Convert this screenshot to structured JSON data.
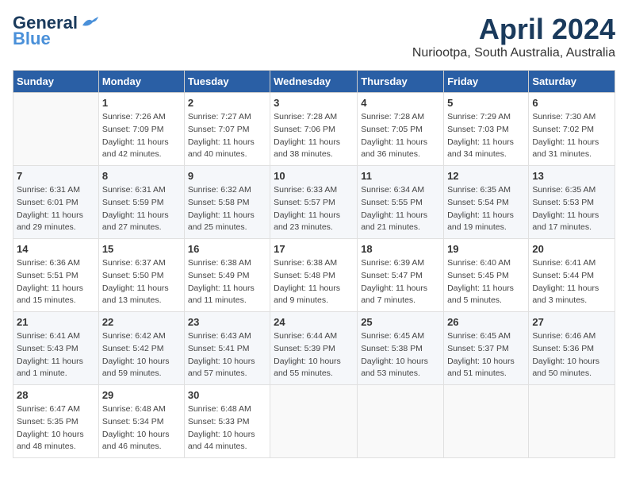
{
  "header": {
    "logo_general": "General",
    "logo_blue": "Blue",
    "month_year": "April 2024",
    "location": "Nuriootpa, South Australia, Australia"
  },
  "columns": [
    "Sunday",
    "Monday",
    "Tuesday",
    "Wednesday",
    "Thursday",
    "Friday",
    "Saturday"
  ],
  "weeks": [
    [
      {
        "day": "",
        "info": ""
      },
      {
        "day": "1",
        "info": "Sunrise: 7:26 AM\nSunset: 7:09 PM\nDaylight: 11 hours\nand 42 minutes."
      },
      {
        "day": "2",
        "info": "Sunrise: 7:27 AM\nSunset: 7:07 PM\nDaylight: 11 hours\nand 40 minutes."
      },
      {
        "day": "3",
        "info": "Sunrise: 7:28 AM\nSunset: 7:06 PM\nDaylight: 11 hours\nand 38 minutes."
      },
      {
        "day": "4",
        "info": "Sunrise: 7:28 AM\nSunset: 7:05 PM\nDaylight: 11 hours\nand 36 minutes."
      },
      {
        "day": "5",
        "info": "Sunrise: 7:29 AM\nSunset: 7:03 PM\nDaylight: 11 hours\nand 34 minutes."
      },
      {
        "day": "6",
        "info": "Sunrise: 7:30 AM\nSunset: 7:02 PM\nDaylight: 11 hours\nand 31 minutes."
      }
    ],
    [
      {
        "day": "7",
        "info": "Sunrise: 6:31 AM\nSunset: 6:01 PM\nDaylight: 11 hours\nand 29 minutes."
      },
      {
        "day": "8",
        "info": "Sunrise: 6:31 AM\nSunset: 5:59 PM\nDaylight: 11 hours\nand 27 minutes."
      },
      {
        "day": "9",
        "info": "Sunrise: 6:32 AM\nSunset: 5:58 PM\nDaylight: 11 hours\nand 25 minutes."
      },
      {
        "day": "10",
        "info": "Sunrise: 6:33 AM\nSunset: 5:57 PM\nDaylight: 11 hours\nand 23 minutes."
      },
      {
        "day": "11",
        "info": "Sunrise: 6:34 AM\nSunset: 5:55 PM\nDaylight: 11 hours\nand 21 minutes."
      },
      {
        "day": "12",
        "info": "Sunrise: 6:35 AM\nSunset: 5:54 PM\nDaylight: 11 hours\nand 19 minutes."
      },
      {
        "day": "13",
        "info": "Sunrise: 6:35 AM\nSunset: 5:53 PM\nDaylight: 11 hours\nand 17 minutes."
      }
    ],
    [
      {
        "day": "14",
        "info": "Sunrise: 6:36 AM\nSunset: 5:51 PM\nDaylight: 11 hours\nand 15 minutes."
      },
      {
        "day": "15",
        "info": "Sunrise: 6:37 AM\nSunset: 5:50 PM\nDaylight: 11 hours\nand 13 minutes."
      },
      {
        "day": "16",
        "info": "Sunrise: 6:38 AM\nSunset: 5:49 PM\nDaylight: 11 hours\nand 11 minutes."
      },
      {
        "day": "17",
        "info": "Sunrise: 6:38 AM\nSunset: 5:48 PM\nDaylight: 11 hours\nand 9 minutes."
      },
      {
        "day": "18",
        "info": "Sunrise: 6:39 AM\nSunset: 5:47 PM\nDaylight: 11 hours\nand 7 minutes."
      },
      {
        "day": "19",
        "info": "Sunrise: 6:40 AM\nSunset: 5:45 PM\nDaylight: 11 hours\nand 5 minutes."
      },
      {
        "day": "20",
        "info": "Sunrise: 6:41 AM\nSunset: 5:44 PM\nDaylight: 11 hours\nand 3 minutes."
      }
    ],
    [
      {
        "day": "21",
        "info": "Sunrise: 6:41 AM\nSunset: 5:43 PM\nDaylight: 11 hours\nand 1 minute."
      },
      {
        "day": "22",
        "info": "Sunrise: 6:42 AM\nSunset: 5:42 PM\nDaylight: 10 hours\nand 59 minutes."
      },
      {
        "day": "23",
        "info": "Sunrise: 6:43 AM\nSunset: 5:41 PM\nDaylight: 10 hours\nand 57 minutes."
      },
      {
        "day": "24",
        "info": "Sunrise: 6:44 AM\nSunset: 5:39 PM\nDaylight: 10 hours\nand 55 minutes."
      },
      {
        "day": "25",
        "info": "Sunrise: 6:45 AM\nSunset: 5:38 PM\nDaylight: 10 hours\nand 53 minutes."
      },
      {
        "day": "26",
        "info": "Sunrise: 6:45 AM\nSunset: 5:37 PM\nDaylight: 10 hours\nand 51 minutes."
      },
      {
        "day": "27",
        "info": "Sunrise: 6:46 AM\nSunset: 5:36 PM\nDaylight: 10 hours\nand 50 minutes."
      }
    ],
    [
      {
        "day": "28",
        "info": "Sunrise: 6:47 AM\nSunset: 5:35 PM\nDaylight: 10 hours\nand 48 minutes."
      },
      {
        "day": "29",
        "info": "Sunrise: 6:48 AM\nSunset: 5:34 PM\nDaylight: 10 hours\nand 46 minutes."
      },
      {
        "day": "30",
        "info": "Sunrise: 6:48 AM\nSunset: 5:33 PM\nDaylight: 10 hours\nand 44 minutes."
      },
      {
        "day": "",
        "info": ""
      },
      {
        "day": "",
        "info": ""
      },
      {
        "day": "",
        "info": ""
      },
      {
        "day": "",
        "info": ""
      }
    ]
  ]
}
